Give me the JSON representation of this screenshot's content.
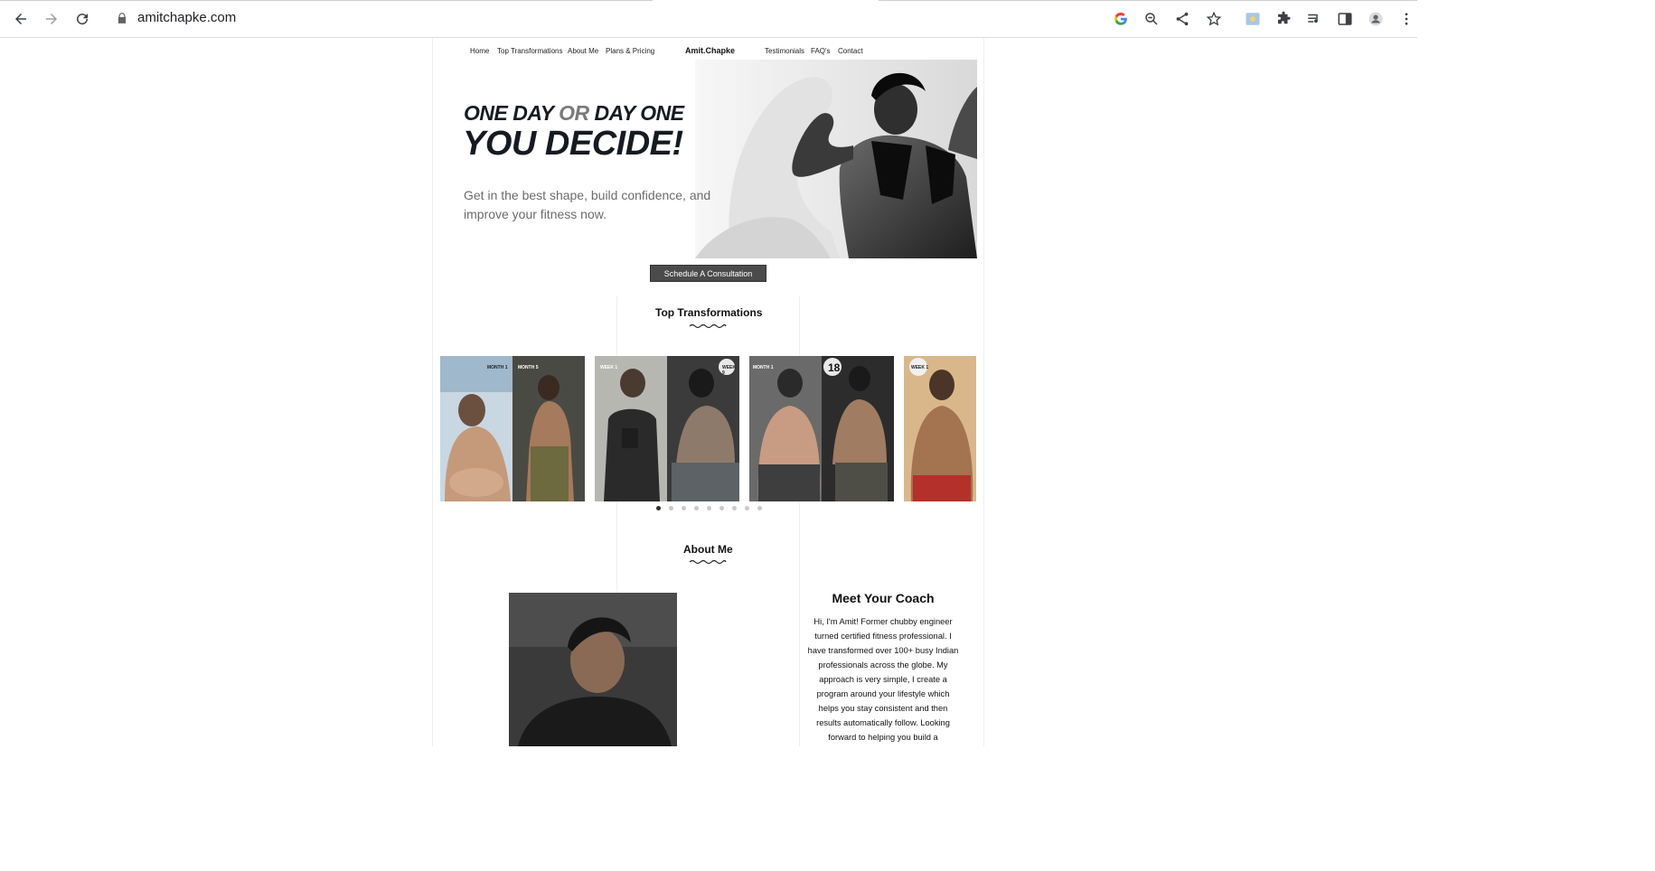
{
  "browser": {
    "url": "amitchapke.com"
  },
  "nav": {
    "home": "Home",
    "top_transformations": "Top Transformations",
    "about_me": "About Me",
    "plans_pricing": "Plans & Pricing",
    "brand": "Amit.Chapke",
    "testimonials": "Testimonials",
    "faqs": "FAQ's",
    "contact": "Contact"
  },
  "hero": {
    "line1_a": "ONE DAY",
    "line1_or": "OR",
    "line1_b": "DAY ONE",
    "line2": "YOU DECIDE!",
    "subtitle": "Get in the best shape, build confidence, and improve your fitness now.",
    "cta": "Schedule A Consultation"
  },
  "transformations": {
    "title": "Top Transformations",
    "cards": [
      {
        "before_badge": "MONTH 1",
        "after_badge": "MONTH 5"
      },
      {
        "before_badge": "WEEK 1",
        "after_badge": "WEEK 9"
      },
      {
        "before_badge": "MONTH 1",
        "after_badge": "18"
      },
      {
        "before_badge": "WEEK 1",
        "after_badge": ""
      }
    ],
    "dot_count": 9,
    "active_dot": 0
  },
  "about": {
    "title": "About Me",
    "coach_title": "Meet Your Coach",
    "coach_text": "Hi, I'm Amit! Former chubby engineer turned certified fitness professional. I have transformed over 100+ busy Indian professionals across the globe. My approach is very simple, I create a program around your lifestyle which helps you stay consistent and then results automatically follow. Looking forward to helping you build a"
  },
  "colors": {
    "cta_bg": "#4b4b4b",
    "hero_dark": "#151b22",
    "hero_or": "#7a7a7a",
    "active_dot": "#333333"
  }
}
